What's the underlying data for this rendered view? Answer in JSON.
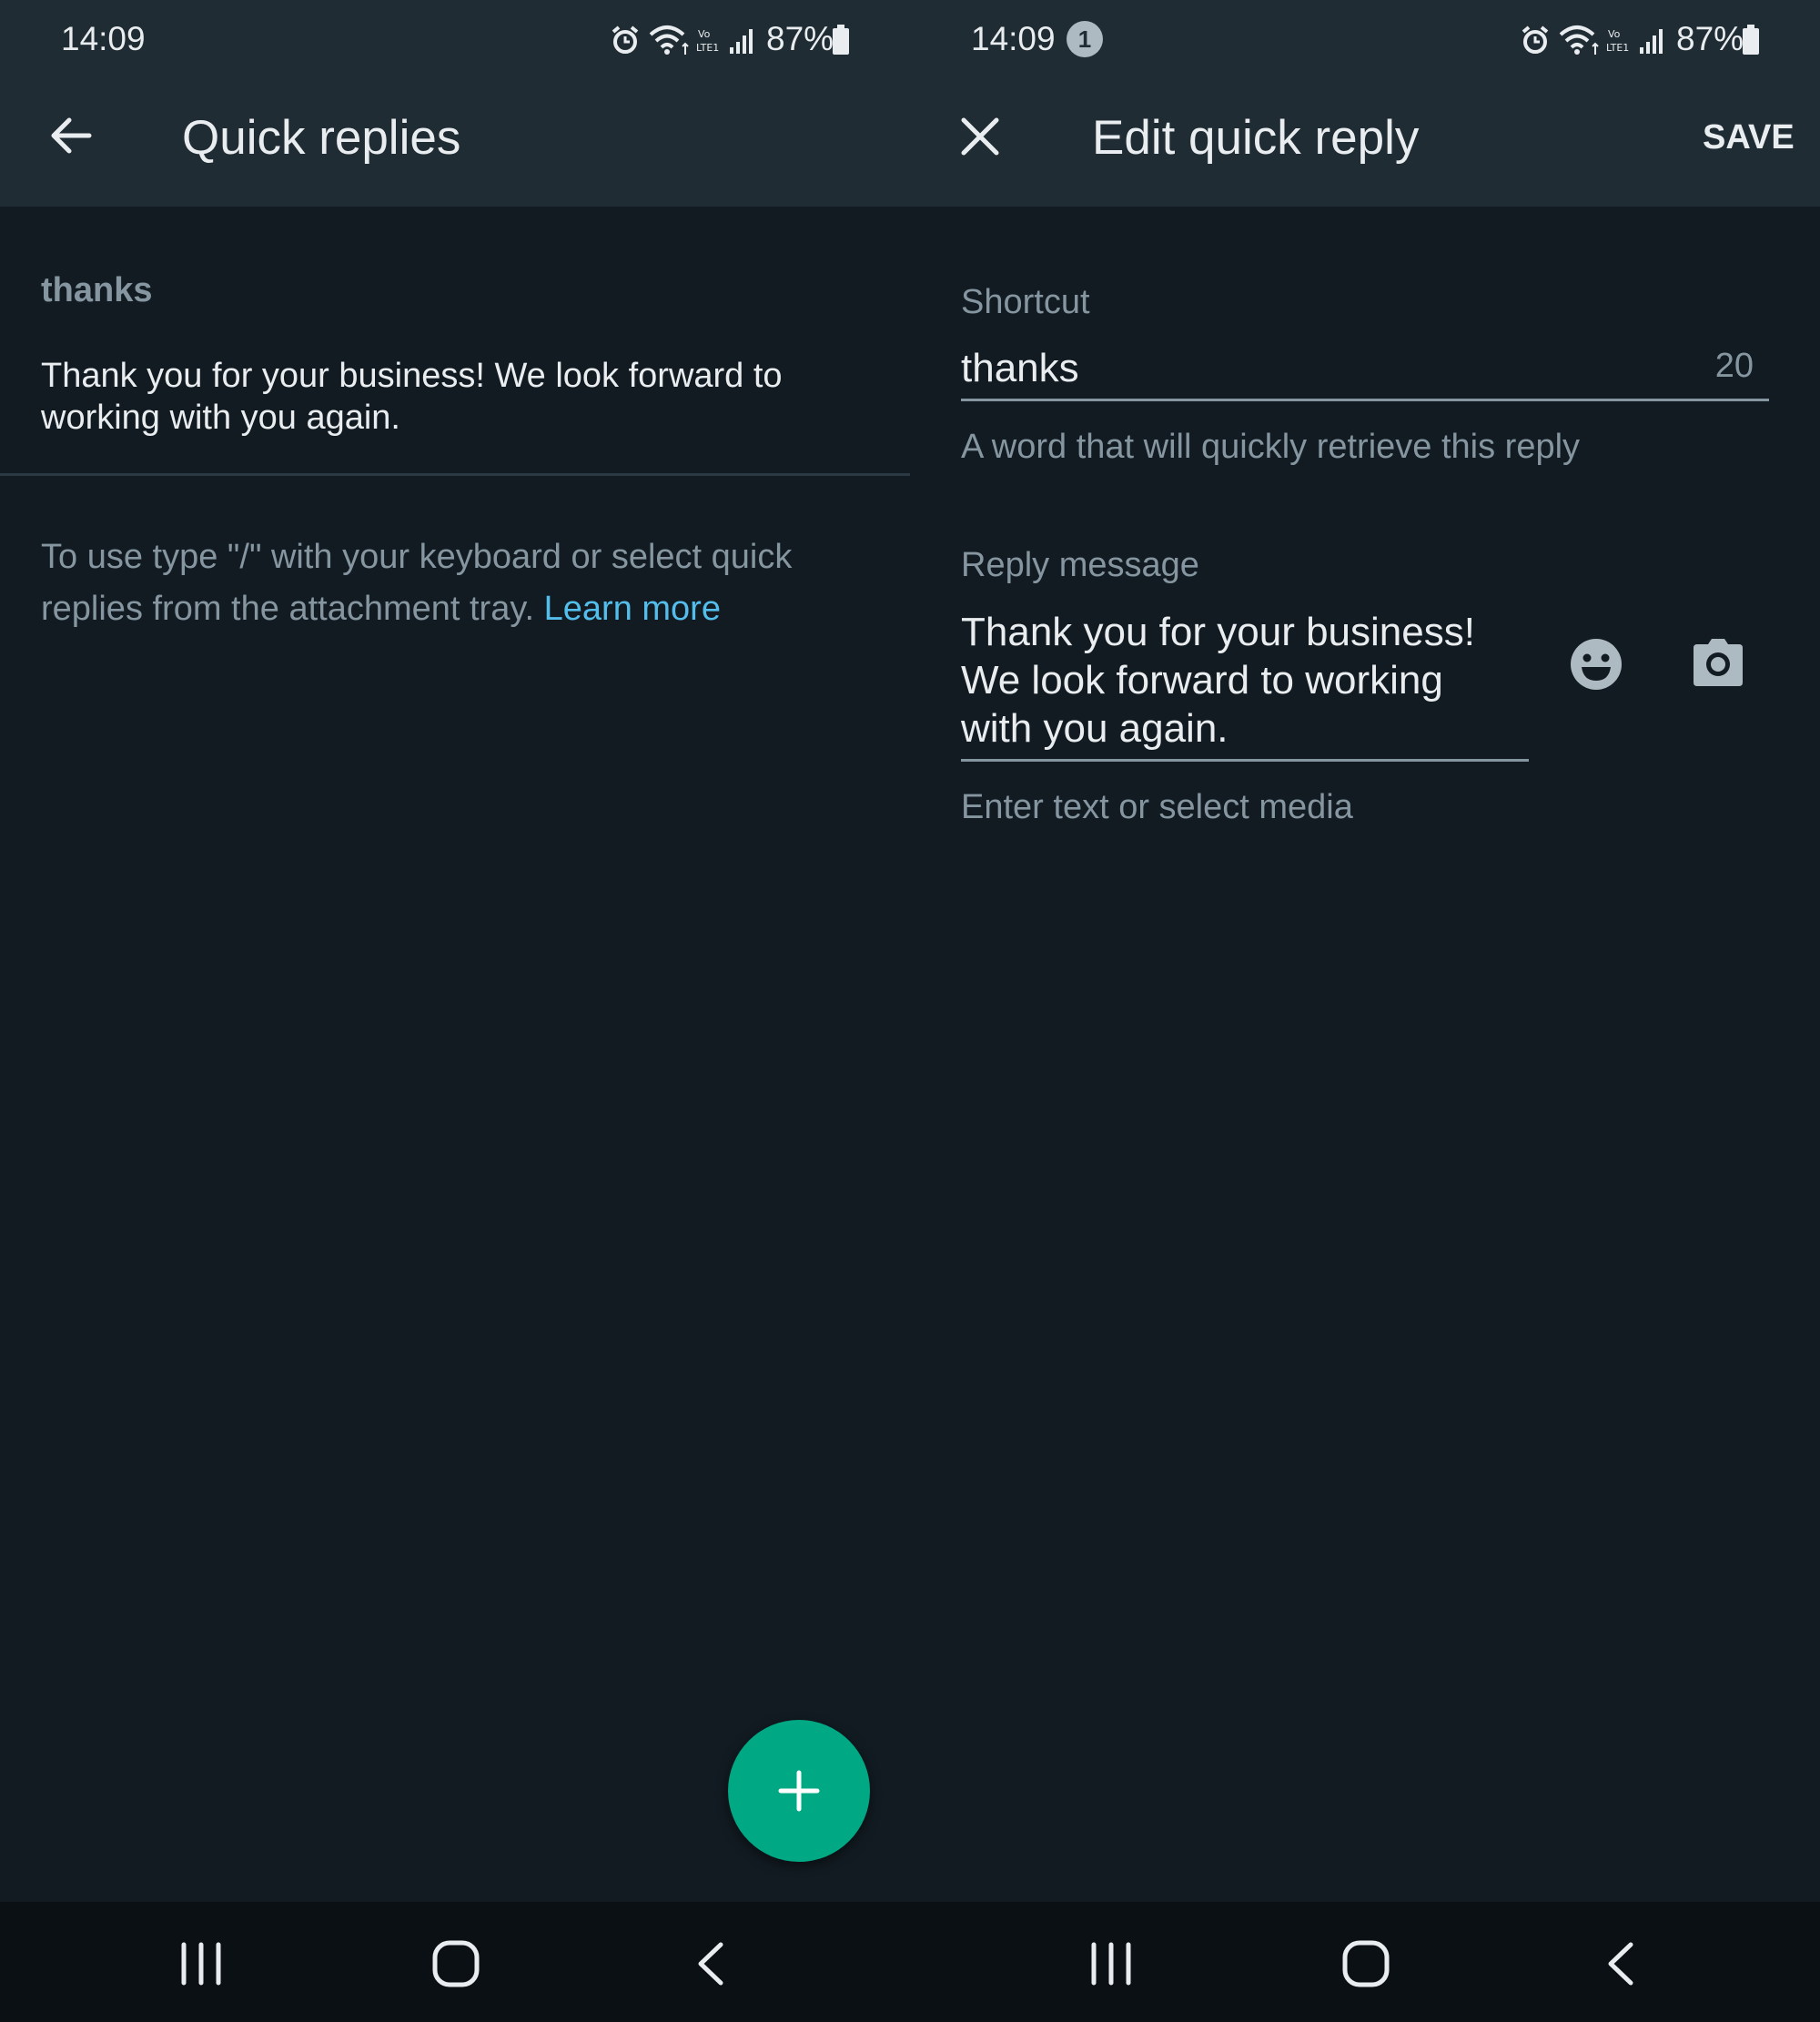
{
  "left": {
    "status": {
      "time": "14:09",
      "battery": "87%"
    },
    "appbar": {
      "title": "Quick replies"
    },
    "item": {
      "shortcut": "thanks",
      "message": "Thank you for your business! We look forward to working with you again."
    },
    "hint": {
      "text": "To use type \"/\" with your keyboard or select quick replies from the attachment tray. ",
      "link": "Learn more"
    }
  },
  "right": {
    "status": {
      "time": "14:09",
      "notification_count": "1",
      "battery": "87%"
    },
    "appbar": {
      "title": "Edit quick reply",
      "save_label": "SAVE"
    },
    "shortcut_field": {
      "label": "Shortcut",
      "value": "thanks",
      "remaining": "20",
      "helper": "A word that will quickly retrieve this reply"
    },
    "message_field": {
      "label": "Reply message",
      "lines": [
        "Thank you for your business!",
        "We look forward to working",
        "with you again."
      ],
      "helper": "Enter text or select media"
    }
  },
  "colors": {
    "bar": "#1f2c34",
    "background": "#121b22",
    "accent": "#00a884",
    "link": "#53bdeb",
    "text_primary": "#e9edef",
    "text_secondary": "#8696a0"
  },
  "icons": {
    "status": [
      "alarm-icon",
      "wifi-icon",
      "volte-icon",
      "signal-icon",
      "battery-icon"
    ],
    "nav": [
      "recents-icon",
      "home-icon",
      "back-icon"
    ]
  }
}
